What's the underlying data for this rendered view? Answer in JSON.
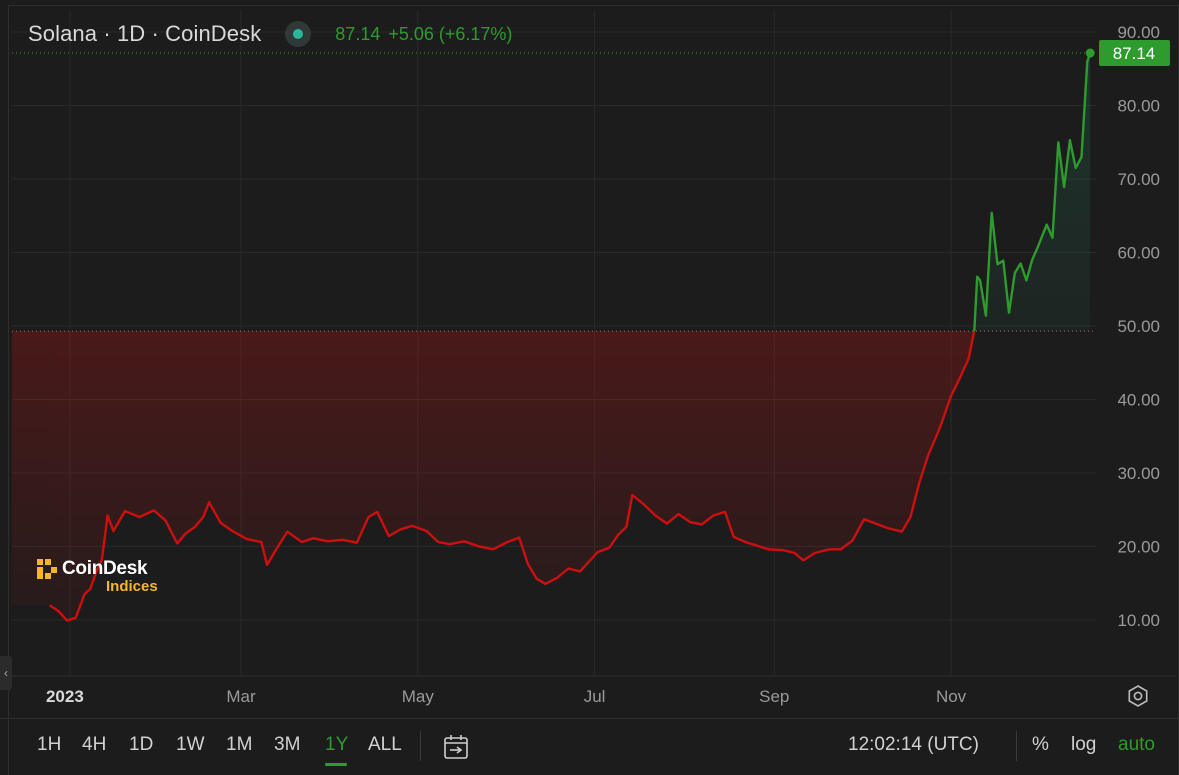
{
  "header": {
    "title": "Solana · 1D · CoinDesk",
    "price": "87.14",
    "change": "+5.06 (+6.17%)"
  },
  "logo": {
    "name": "CoinDesk",
    "sub": "Indices"
  },
  "colors": {
    "up": "#2e9b2e",
    "down": "#cc1010",
    "background": "#1c1c1c",
    "grid": "#2a2a2a",
    "axis_text": "#9a9a9a"
  },
  "toolbar": {
    "ranges": [
      "1H",
      "4H",
      "1D",
      "1W",
      "1M",
      "3M",
      "1Y",
      "ALL"
    ],
    "active_range": "1Y",
    "time": "12:02:14 (UTC)",
    "percent": "%",
    "log": "log",
    "auto": "auto"
  },
  "chart_data": {
    "type": "area",
    "title": "Solana · 1D · CoinDesk",
    "xlabel": "",
    "ylabel": "",
    "y_ticks": [
      "10.00",
      "20.00",
      "30.00",
      "40.00",
      "50.00",
      "60.00",
      "70.00",
      "80.00",
      "90.00"
    ],
    "x_ticks": [
      {
        "label": "2023",
        "date": "2023-01-01"
      },
      {
        "label": "Mar",
        "date": "2023-03-01"
      },
      {
        "label": "May",
        "date": "2023-05-01"
      },
      {
        "label": "Jul",
        "date": "2023-07-01"
      },
      {
        "label": "Sep",
        "date": "2023-09-01"
      },
      {
        "label": "Nov",
        "date": "2023-11-01"
      }
    ],
    "ylim": [
      2.5,
      93
    ],
    "xlim": [
      "2022-12-12",
      "2023-12-21"
    ],
    "grid": true,
    "baseline": 49.3,
    "last_value": 87.14,
    "series": [
      {
        "points": [
          [
            "2022-12-25",
            12.0
          ],
          [
            "2022-12-28",
            11.2
          ],
          [
            "2022-12-31",
            9.9
          ],
          [
            "2023-01-03",
            10.3
          ],
          [
            "2023-01-06",
            13.5
          ],
          [
            "2023-01-08",
            14.2
          ],
          [
            "2023-01-10",
            16.5
          ],
          [
            "2023-01-12",
            18.2
          ],
          [
            "2023-01-14",
            24.2
          ],
          [
            "2023-01-16",
            22.1
          ],
          [
            "2023-01-20",
            24.8
          ],
          [
            "2023-01-25",
            24.0
          ],
          [
            "2023-01-30",
            24.9
          ],
          [
            "2023-02-03",
            23.5
          ],
          [
            "2023-02-07",
            20.4
          ],
          [
            "2023-02-10",
            21.8
          ],
          [
            "2023-02-13",
            22.6
          ],
          [
            "2023-02-16",
            24.0
          ],
          [
            "2023-02-18",
            26.0
          ],
          [
            "2023-02-22",
            23.2
          ],
          [
            "2023-02-26",
            22.1
          ],
          [
            "2023-03-03",
            21.0
          ],
          [
            "2023-03-08",
            20.6
          ],
          [
            "2023-03-10",
            17.5
          ],
          [
            "2023-03-13",
            19.5
          ],
          [
            "2023-03-17",
            22.0
          ],
          [
            "2023-03-22",
            20.6
          ],
          [
            "2023-03-26",
            21.1
          ],
          [
            "2023-03-31",
            20.7
          ],
          [
            "2023-04-05",
            20.9
          ],
          [
            "2023-04-10",
            20.5
          ],
          [
            "2023-04-14",
            24.0
          ],
          [
            "2023-04-17",
            24.7
          ],
          [
            "2023-04-21",
            21.4
          ],
          [
            "2023-04-25",
            22.3
          ],
          [
            "2023-04-29",
            22.8
          ],
          [
            "2023-05-04",
            22.1
          ],
          [
            "2023-05-08",
            20.6
          ],
          [
            "2023-05-12",
            20.3
          ],
          [
            "2023-05-17",
            20.7
          ],
          [
            "2023-05-22",
            20.0
          ],
          [
            "2023-05-27",
            19.6
          ],
          [
            "2023-06-01",
            20.6
          ],
          [
            "2023-06-05",
            21.2
          ],
          [
            "2023-06-08",
            17.6
          ],
          [
            "2023-06-11",
            15.6
          ],
          [
            "2023-06-14",
            14.9
          ],
          [
            "2023-06-18",
            15.7
          ],
          [
            "2023-06-22",
            17.0
          ],
          [
            "2023-06-26",
            16.6
          ],
          [
            "2023-06-29",
            17.9
          ],
          [
            "2023-07-02",
            19.2
          ],
          [
            "2023-07-06",
            19.8
          ],
          [
            "2023-07-09",
            21.5
          ],
          [
            "2023-07-12",
            22.7
          ],
          [
            "2023-07-14",
            27.0
          ],
          [
            "2023-07-18",
            25.7
          ],
          [
            "2023-07-22",
            24.2
          ],
          [
            "2023-07-26",
            23.1
          ],
          [
            "2023-07-30",
            24.4
          ],
          [
            "2023-08-03",
            23.3
          ],
          [
            "2023-08-07",
            23.0
          ],
          [
            "2023-08-11",
            24.2
          ],
          [
            "2023-08-15",
            24.7
          ],
          [
            "2023-08-18",
            21.3
          ],
          [
            "2023-08-22",
            20.6
          ],
          [
            "2023-08-26",
            20.1
          ],
          [
            "2023-08-30",
            19.6
          ],
          [
            "2023-09-04",
            19.5
          ],
          [
            "2023-09-08",
            19.1
          ],
          [
            "2023-09-11",
            18.1
          ],
          [
            "2023-09-15",
            19.1
          ],
          [
            "2023-09-20",
            19.6
          ],
          [
            "2023-09-24",
            19.6
          ],
          [
            "2023-09-28",
            20.8
          ],
          [
            "2023-10-02",
            23.7
          ],
          [
            "2023-10-06",
            23.1
          ],
          [
            "2023-10-10",
            22.5
          ],
          [
            "2023-10-15",
            22.0
          ],
          [
            "2023-10-18",
            24.0
          ],
          [
            "2023-10-21",
            28.6
          ],
          [
            "2023-10-24",
            32.3
          ],
          [
            "2023-10-28",
            36.0
          ],
          [
            "2023-11-01",
            40.5
          ],
          [
            "2023-11-04",
            42.9
          ],
          [
            "2023-11-07",
            45.5
          ],
          [
            "2023-11-09",
            49.3
          ]
        ]
      },
      {
        "points": [
          [
            "2023-11-09",
            49.3
          ],
          [
            "2023-11-10",
            56.7
          ],
          [
            "2023-11-11",
            56.2
          ],
          [
            "2023-11-13",
            51.4
          ],
          [
            "2023-11-15",
            65.4
          ],
          [
            "2023-11-17",
            58.4
          ],
          [
            "2023-11-19",
            58.9
          ],
          [
            "2023-11-21",
            51.8
          ],
          [
            "2023-11-23",
            57.2
          ],
          [
            "2023-11-25",
            58.5
          ],
          [
            "2023-11-27",
            56.2
          ],
          [
            "2023-11-29",
            59.0
          ],
          [
            "2023-12-01",
            60.8
          ],
          [
            "2023-12-04",
            63.8
          ],
          [
            "2023-12-06",
            62.0
          ],
          [
            "2023-12-08",
            75.0
          ],
          [
            "2023-12-10",
            68.9
          ],
          [
            "2023-12-12",
            75.3
          ],
          [
            "2023-12-14",
            71.5
          ],
          [
            "2023-12-16",
            73.0
          ],
          [
            "2023-12-18",
            86.0
          ],
          [
            "2023-12-19",
            87.14
          ]
        ]
      }
    ]
  }
}
